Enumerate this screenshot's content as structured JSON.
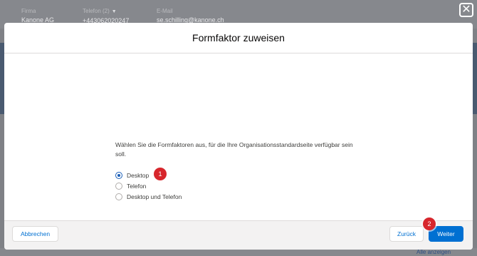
{
  "background": {
    "fields": [
      {
        "label": "Firma",
        "value": "Kanone AG"
      },
      {
        "label": "Telefon (2)",
        "value": "+443062020247"
      },
      {
        "label": "E-Mail",
        "value": "se.schilling@kanone.ch"
      }
    ],
    "link": "Alle anzeigen",
    "close_symbol": "✕"
  },
  "modal": {
    "title": "Formfaktor zuweisen",
    "instruction": "Wählen Sie die Formfaktoren aus, für die Ihre Organisationsstandardseite verfügbar sein soll.",
    "options": [
      {
        "label": "Desktop",
        "checked": true
      },
      {
        "label": "Telefon",
        "checked": false
      },
      {
        "label": "Desktop und Telefon",
        "checked": false
      }
    ],
    "badges": [
      "1",
      "2"
    ]
  },
  "footer": {
    "cancel_label": "Abbrechen",
    "back_label": "Zurück",
    "next_label": "Weiter"
  },
  "colors": {
    "brand": "#0070d2",
    "badge": "#d7262c",
    "overlay": "#7f8186"
  }
}
